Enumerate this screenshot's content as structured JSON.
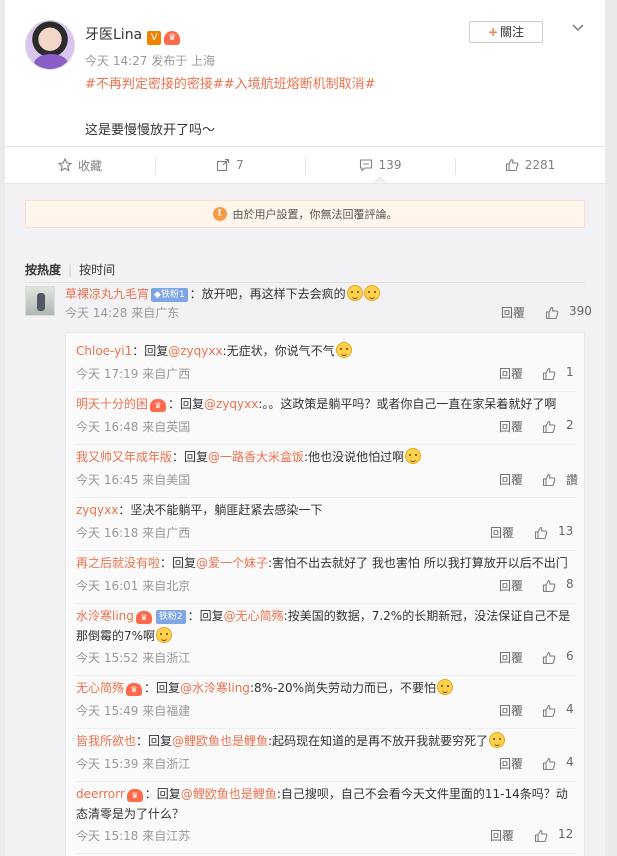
{
  "post": {
    "user_name": "牙医Lina",
    "v_badge": "V",
    "meta": "今天 14:27 发布于 上海",
    "tags": "#不再判定密接的密接##入境航班熔断机制取消#",
    "content": "这是要慢慢放开了吗～",
    "follow_label": "關注"
  },
  "actions": {
    "collect_label": "收藏",
    "repost_count": "7",
    "comment_count": "139",
    "like_count": "2281"
  },
  "notice": "由於用户設置，你無法回覆評論。",
  "sort": {
    "hot": "按热度",
    "time": "按时间"
  },
  "top_comment": {
    "user": "草裸凉丸九毛宵",
    "level": "铁粉1",
    "text": "：放开吧，再这样下去会疯的",
    "footer": "今天 14:28 来自广东",
    "reply": "回覆",
    "likes": "390"
  },
  "replies": [
    {
      "user": "Chloe-yi1",
      "crown": false,
      "level": "",
      "reply_to": "@zyqyxx",
      "text": ":无症状，你说气不气",
      "emoji": true,
      "footer": "今天 17:19 来自广西",
      "reply": "回覆",
      "likes": "1"
    },
    {
      "user": "明天十分的困",
      "crown": true,
      "level": "",
      "reply_to": "@zyqyxx",
      "text": ":。。这政策是躺平吗？或者你自己一直在家呆着就好了啊",
      "emoji": false,
      "footer": "今天 16:48 来自英国",
      "reply": "回覆",
      "likes": "2"
    },
    {
      "user": "我又帅又年成年版",
      "crown": false,
      "level": "",
      "reply_to": "@一路香大米盒饭",
      "text": ":他也没说他怕过啊",
      "emoji": true,
      "footer": "今天 16:45 来自美国",
      "reply": "回覆",
      "likes": "讚"
    },
    {
      "user": "zyqyxx",
      "crown": false,
      "level": "",
      "reply_to": "",
      "text": "：坚决不能躺平，躺匪赶紧去感染一下",
      "emoji": false,
      "footer": "今天 16:18 来自广西",
      "reply": "回覆",
      "likes": "13"
    },
    {
      "user": "再之后就没有啦",
      "crown": false,
      "level": "",
      "reply_to": "@爱一个妹子",
      "text": ":害怕不出去就好了 我也害怕 所以我打算放开以后不出门",
      "emoji": false,
      "footer": "今天 16:01 来自北京",
      "reply": "回覆",
      "likes": "8"
    },
    {
      "user": "水泠寒ling",
      "crown": true,
      "level": "铁粉2",
      "reply_to": "@无心简殇",
      "text": ":按美国的数据，7.2%的长期新冠，没法保证自己不是那倒霉的7%啊",
      "emoji": true,
      "footer": "今天 15:52 来自浙江",
      "reply": "回覆",
      "likes": "6"
    },
    {
      "user": "无心简殇",
      "crown": true,
      "level": "",
      "reply_to": "@水泠寒ling",
      "text": ":8%-20%尚失劳动力而已，不要怕",
      "emoji": true,
      "footer": "今天 15:49 来自福建",
      "reply": "回覆",
      "likes": "4"
    },
    {
      "user": "皆我所欲也",
      "crown": false,
      "level": "",
      "reply_to": "@鲤欧鱼也是鲤鱼",
      "text": ":起码现在知道的是再不放开我就要穷死了",
      "emoji": true,
      "footer": "今天 15:39 来自浙江",
      "reply": "回覆",
      "likes": "4"
    },
    {
      "user": "deerrorr",
      "crown": true,
      "level": "",
      "reply_to": "@鲤欧鱼也是鲤鱼",
      "text": ":自己搜呗，自己不会看今天文件里面的11-14条吗？动态清零是为了什么？",
      "emoji": false,
      "footer": "今天 15:18 来自江苏",
      "reply": "回覆",
      "likes": "12"
    }
  ],
  "reply_prefix": "：回复"
}
